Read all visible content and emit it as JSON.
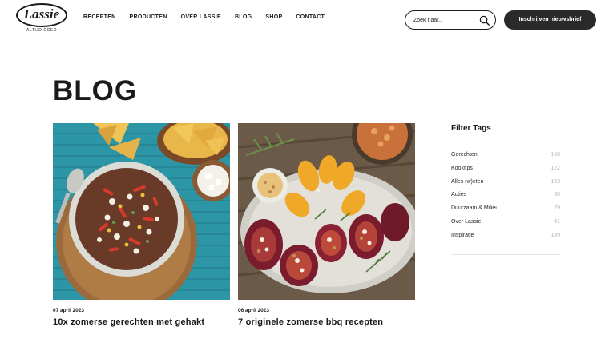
{
  "brand": {
    "name": "Lassie",
    "tagline": "ALTIJD GOED"
  },
  "nav": {
    "items": [
      {
        "label": "RECEPTEN"
      },
      {
        "label": "PRODUCTEN"
      },
      {
        "label": "OVER LASSIE"
      },
      {
        "label": "BLOG"
      },
      {
        "label": "SHOP"
      },
      {
        "label": "CONTACT"
      }
    ]
  },
  "search": {
    "placeholder": "Zoek naar..",
    "icon": "search-icon"
  },
  "subscribe": {
    "label": "Inschrijven nieuwsbrief"
  },
  "page": {
    "title": "BLOG"
  },
  "posts": [
    {
      "date": "07 april 2023",
      "title": "10x zomerse gerechten met gehakt",
      "image": "bowl-salad-photo"
    },
    {
      "date": "06 april 2023",
      "title": "7 originele zomerse bbq recepten",
      "image": "grilled-vegetables-photo"
    }
  ],
  "filter": {
    "title": "Filter Tags",
    "tags": [
      {
        "label": "Gerechten",
        "count": "168"
      },
      {
        "label": "Kooktips",
        "count": "122"
      },
      {
        "label": "Alles (w)eten",
        "count": "159"
      },
      {
        "label": "Acties",
        "count": "50"
      },
      {
        "label": "Duurzaam & Milieu",
        "count": "79"
      },
      {
        "label": "Over Lassie",
        "count": "41"
      },
      {
        "label": "Inspiratie",
        "count": "189"
      }
    ]
  },
  "colors": {
    "text": "#1a1a1a",
    "button": "#2a2a2a",
    "count": "#b5b5b5",
    "teal": "#2a8fa0"
  }
}
